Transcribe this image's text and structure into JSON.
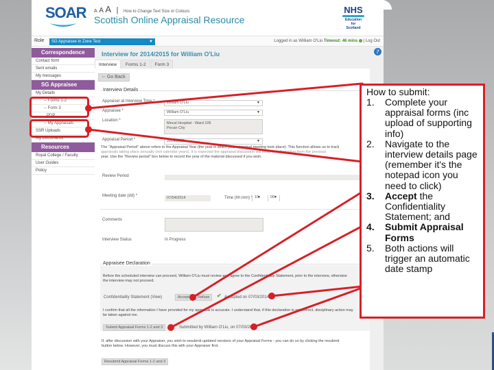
{
  "header": {
    "logo_text": "SOAR",
    "text_size_glyphs": [
      "A",
      "A",
      "A"
    ],
    "text_size_link": "How to Change Text Size or Colours",
    "site_title": "Scottish Online Appraisal Resource",
    "nhs_logo": {
      "word": "NHS",
      "sub": [
        "Education",
        "for",
        "Scotland"
      ]
    }
  },
  "role_bar": {
    "label": "Role",
    "selected_role": "SG Appraisee in Zone Test",
    "logged_in_text": "Logged in as William O'Liu",
    "timeout_text": "Timeout: 46 mins",
    "logout_label": "Log Out"
  },
  "sidebar": {
    "sections": [
      {
        "heading": "Correspondence",
        "items": [
          {
            "label": "Contact form",
            "level": 0
          },
          {
            "label": "Sent emails",
            "level": 0
          },
          {
            "label": "My messages",
            "level": 0
          }
        ]
      },
      {
        "heading": "SG Appraisee",
        "items": [
          {
            "label": "My Details",
            "level": 0
          },
          {
            "label": "-- Forms 1-2",
            "level": 1
          },
          {
            "label": "-- Form 3",
            "level": 1
          },
          {
            "label": "PDP",
            "level": 2
          },
          {
            "label": "-- My Appraisals",
            "level": 1
          },
          {
            "label": "SSR Uploads",
            "level": 0
          },
          {
            "label": "My Documents",
            "level": 0
          }
        ]
      },
      {
        "heading": "Resources",
        "items": [
          {
            "label": "Royal College / Faculty",
            "level": 0
          },
          {
            "label": "User Guides",
            "level": 0
          },
          {
            "label": "Policy",
            "level": 0
          }
        ]
      }
    ]
  },
  "main": {
    "title": "Interview for 2014/2015 for William O'Liu",
    "tabs": [
      {
        "label": "Interview",
        "active": true
      },
      {
        "label": "Forms 1-2",
        "active": false
      },
      {
        "label": "Form 3",
        "active": false
      }
    ],
    "go_back_label": "Go Back",
    "interview_details": {
      "legend": "Interview Details",
      "appraiser_label": "Appraiser at Interview Time *",
      "appraiser_value": "William O'Liu",
      "appraisee_label": "Appraisee *",
      "appraisee_value": "William O'Liu",
      "location_label": "Location *",
      "location_value": [
        "Mecal Hospital - Ward 105",
        "Pecan City"
      ],
      "appraisal_period_label": "Appraisal Period *",
      "appraisal_period_value": "2014/2015",
      "period_note": [
        "The \"Appraisal Period\" above refers to the Appraisal Year (the year in which your appraisal meeting took place). This function allows us to track",
        "appraisals taking place annually (not calendar years). It is expected the appraisal discussion will focus on information from the previous",
        "year. Use the \"Review period\" box below to record the year of the material discussed if you wish."
      ],
      "review_period_label": "Review Period",
      "review_period_value": "",
      "meeting_date_label": "Meeting date (dd) *",
      "meeting_date_value": "07/04/2014",
      "time_label": "Time (hh:mm) *",
      "time_hour": "10",
      "time_minute": "00",
      "comments_label": "Comments",
      "comments_value": "",
      "status_label": "Interview Status",
      "status_value": "In Progress"
    },
    "declaration": {
      "legend": "Appraisee Declaration",
      "intro": [
        "Before the scheduled interview can proceed, William O'Liu must review and agree to the Confidentiality Statement, prior to the interview, otherwise",
        "the interview may not proceed."
      ],
      "confidentiality_label": "Confidentiality Statement (View)",
      "accept_label": "Accept",
      "refuse_label": "Refuse",
      "accepted_text": "Accepted on 07/03/2014",
      "confirm_text": [
        "I confirm that all the information I have provided for my appraisal is accurate. I understand that, if this declaration is not correct, disciplinary action may",
        "be taken against me."
      ],
      "submit_label": "Submit Appraisal Forms 1-2 and 3",
      "submitted_text": "Submitted by William O'Liu, on 07/03/2014"
    },
    "resubmit_note": [
      "If, after discussion with your Appraiser, you wish to resubmit updated versions of your Appraisal Forms - you can do so by clicking the resubmit",
      "button below. However, you must discuss this with your Appraiser first."
    ],
    "resubmit_label": "Resubmit Appraisal Forms 1-2 and 3"
  },
  "callout": {
    "heading": "How to submit:",
    "steps": [
      {
        "num": "1.",
        "bold": "",
        "text": "Complete your appraisal forms (inc upload of supporting info)"
      },
      {
        "num": "2.",
        "bold": "",
        "text": "Navigate to the interview details page (remember it's the notepad icon you need to click)"
      },
      {
        "num": "3.",
        "bold": "Accept",
        "text": " the Confidentiality Statement; and"
      },
      {
        "num": "4.",
        "bold": "Submit Appraisal Forms",
        "text": ""
      },
      {
        "num": "5.",
        "bold": "",
        "text": "Both actions will trigger an automatic date stamp"
      }
    ]
  },
  "colors": {
    "sidebar_heading": "#8f5b9c",
    "title_blue": "#3a8fb0",
    "role_select": "#1689c4",
    "annotation_red": "#d71f26"
  }
}
